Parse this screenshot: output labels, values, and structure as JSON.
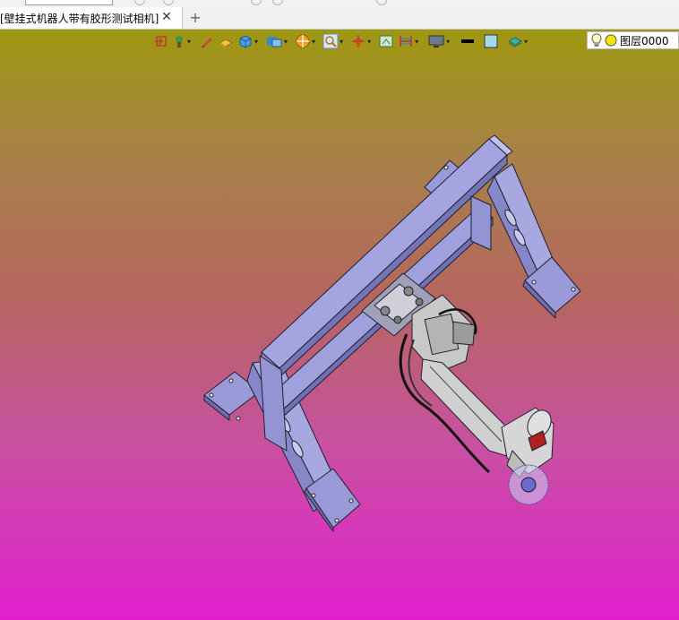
{
  "document_tab": {
    "title": "[壁挂式机器人带有胶形测试相机]",
    "close_glyph": "✕"
  },
  "new_tab_glyph": "+",
  "toolbar": {
    "layer": {
      "name": "图层0000",
      "color": "#f2e600"
    },
    "icons": [
      "import-icon",
      "color-picker-icon",
      "pen-icon",
      "shading-icon",
      "solid-view-icon",
      "display-mode-icon",
      "section-icon",
      "zoom-icon",
      "axis-icon",
      "frame-view-icon",
      "ruler-icon",
      "monitor-icon",
      "line-weight-icon",
      "background-color-icon",
      "layer-icon",
      "lightbulb-icon"
    ]
  },
  "colors": {
    "viewport_top": "#9e9810",
    "viewport_bottom": "#e21ed0",
    "model_fill": "#9a9ad8",
    "model_edge": "#222233",
    "robot_fill": "#c8c8c8"
  }
}
